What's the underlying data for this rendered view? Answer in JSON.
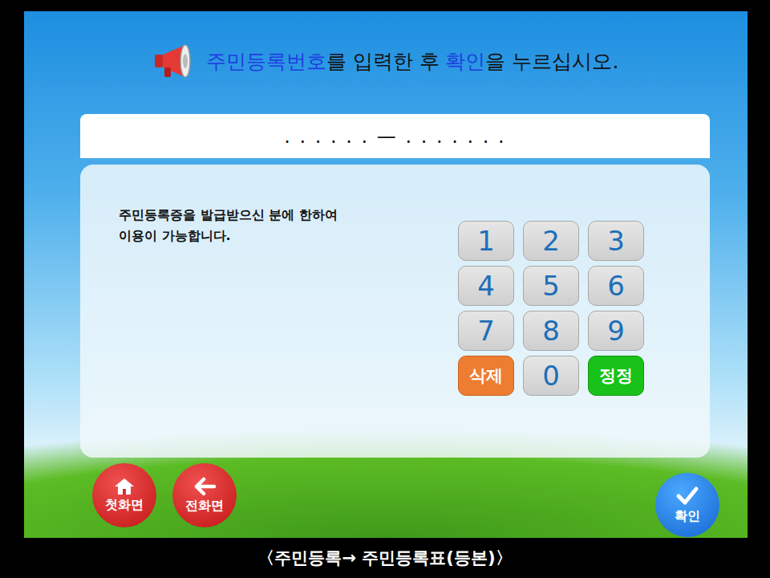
{
  "title": [
    {
      "text": "주민등록번호",
      "highlight": true
    },
    {
      "text": "를 입력한 후 ",
      "highlight": false
    },
    {
      "text": "확인",
      "highlight": true
    },
    {
      "text": "을 누르십시오.",
      "highlight": false
    }
  ],
  "input": {
    "display": ". . . . . . — . . . . . . ."
  },
  "notice": [
    "주민등록증을 발급받으신 분에 한하여",
    "이용이 가능합니다."
  ],
  "keys": [
    {
      "label": "1",
      "kind": "digit"
    },
    {
      "label": "2",
      "kind": "digit"
    },
    {
      "label": "3",
      "kind": "digit"
    },
    {
      "label": "4",
      "kind": "digit"
    },
    {
      "label": "5",
      "kind": "digit"
    },
    {
      "label": "6",
      "kind": "digit"
    },
    {
      "label": "7",
      "kind": "digit"
    },
    {
      "label": "8",
      "kind": "digit"
    },
    {
      "label": "9",
      "kind": "digit"
    },
    {
      "label": "삭제",
      "kind": "delete"
    },
    {
      "label": "0",
      "kind": "digit"
    },
    {
      "label": "정정",
      "kind": "correct"
    }
  ],
  "nav": [
    {
      "label": "첫화면",
      "kind": "home"
    },
    {
      "label": "전화면",
      "kind": "back"
    }
  ],
  "confirm": {
    "label": "확인"
  },
  "caption": "〈주민등록→ 주민등록표(등본)〉"
}
